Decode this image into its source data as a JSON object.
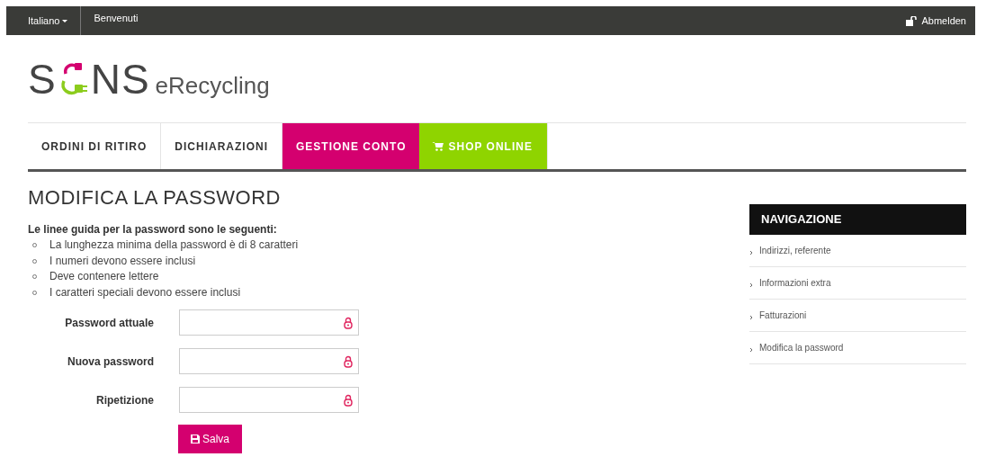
{
  "topbar": {
    "language": "Italiano",
    "welcome": "Benvenuti",
    "logout": "Abmelden"
  },
  "logo": {
    "first": "S",
    "rest": "NS",
    "suffix": "eRecycling"
  },
  "tabs": [
    {
      "label": "ORDINI DI RITIRO",
      "kind": "link",
      "selected": false
    },
    {
      "label": "DICHIARAZIONI",
      "kind": "link",
      "selected": false
    },
    {
      "label": "GESTIONE CONTO",
      "kind": "link",
      "selected": true
    },
    {
      "label": "SHOP ONLINE",
      "kind": "shop",
      "selected": false
    }
  ],
  "page_title": "MODIFICA LA PASSWORD",
  "guidelines": {
    "intro": "Le linee guida per la password sono le seguenti:",
    "items": [
      "La lunghezza minima della password è di 8 caratteri",
      "I numeri devono essere inclusi",
      "Deve contenere lettere",
      "I caratteri speciali devono essere inclusi"
    ]
  },
  "fields": [
    {
      "label": "Password attuale"
    },
    {
      "label": "Nuova password"
    },
    {
      "label": "Ripetizione"
    }
  ],
  "save_button": "Salva",
  "navigation": {
    "title": "NAVIGAZIONE",
    "items": [
      "Indirizzi, referente",
      "Informazioni extra",
      "Fatturazioni",
      "Modifica la password"
    ]
  }
}
